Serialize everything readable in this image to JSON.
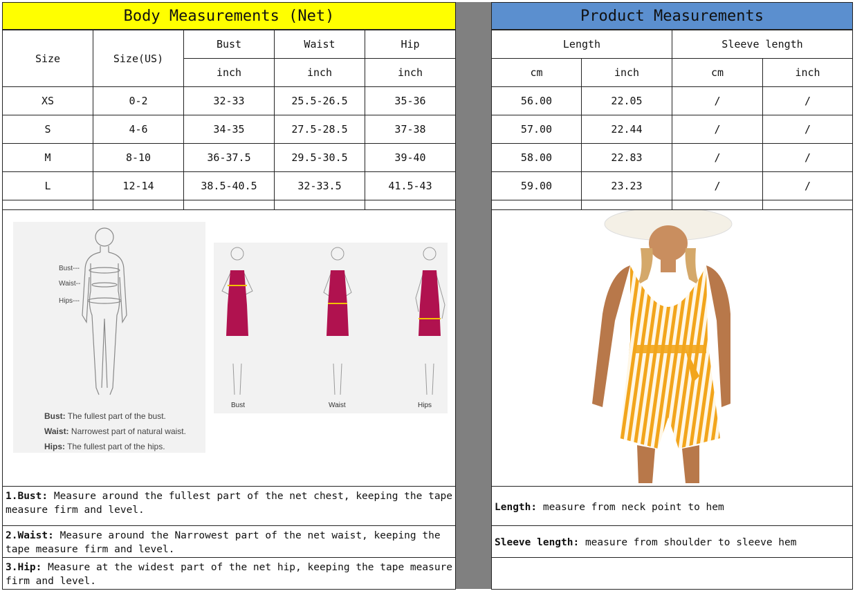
{
  "body_title": "Body Measurements (Net)",
  "product_title": "Product Measurements",
  "body_headers": {
    "size": "Size",
    "size_us": "Size(US)",
    "bust": "Bust",
    "waist": "Waist",
    "hip": "Hip",
    "unit": "inch"
  },
  "product_headers": {
    "length": "Length",
    "sleeve": "Sleeve length",
    "cm": "cm",
    "inch": "inch"
  },
  "rows": [
    {
      "size": "XS",
      "us": "0-2",
      "bust": "32-33",
      "waist": "25.5-26.5",
      "hip": "35-36",
      "len_cm": "56.00",
      "len_in": "22.05",
      "sl_cm": "/",
      "sl_in": "/"
    },
    {
      "size": "S",
      "us": "4-6",
      "bust": "34-35",
      "waist": "27.5-28.5",
      "hip": "37-38",
      "len_cm": "57.00",
      "len_in": "22.44",
      "sl_cm": "/",
      "sl_in": "/"
    },
    {
      "size": "M",
      "us": "8-10",
      "bust": "36-37.5",
      "waist": "29.5-30.5",
      "hip": "39-40",
      "len_cm": "58.00",
      "len_in": "22.83",
      "sl_cm": "/",
      "sl_in": "/"
    },
    {
      "size": "L",
      "us": "12-14",
      "bust": "38.5-40.5",
      "waist": "32-33.5",
      "hip": "41.5-43",
      "len_cm": "59.00",
      "len_in": "23.23",
      "sl_cm": "/",
      "sl_in": "/"
    }
  ],
  "diagram": {
    "bust_tag": "Bust---",
    "waist_tag": "Waist--",
    "hips_tag": "Hips---",
    "bust_label": "Bust:",
    "bust_desc": "The fullest part of the bust.",
    "waist_label": "Waist:",
    "waist_desc": "Narrowest part of natural waist.",
    "hips_label": "Hips:",
    "hips_desc": "The fullest part of the hips.",
    "fig1": "Bust",
    "fig2": "Waist",
    "fig3": "Hips"
  },
  "notes": {
    "bust_k": "1.Bust:",
    "bust_v": " Measure around the fullest part of the net chest, keeping the tape  measure firm and level.",
    "waist_k": "2.Waist:",
    "waist_v": " Measure around the Narrowest part of the net waist, keeping the tape  measure firm and level.",
    "hip_k": "3.Hip:",
    "hip_v": " Measure at the widest part of the net hip, keeping the tape measure firm and level.",
    "length_k": "Length:",
    "length_v": " measure from neck point to hem",
    "sleeve_k": "Sleeve length:",
    "sleeve_v": " measure from shoulder to sleeve hem"
  },
  "colors": {
    "yellow": "#ffff00",
    "blue": "#5b8fcf",
    "gray": "#808080",
    "dress": "#b0124f",
    "stripe": "#f2a51c"
  }
}
